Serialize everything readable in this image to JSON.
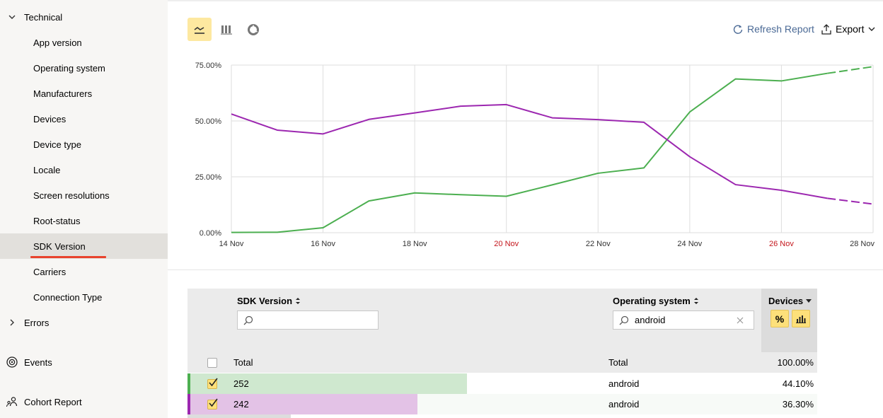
{
  "sidebar": {
    "technical": "Technical",
    "items": [
      "App version",
      "Operating system",
      "Manufacturers",
      "Devices",
      "Device type",
      "Locale",
      "Screen resolutions",
      "Root-status",
      "SDK Version",
      "Carriers",
      "Connection Type"
    ],
    "active_item": "SDK Version",
    "errors": "Errors",
    "events": "Events",
    "cohort": "Cohort Report"
  },
  "toolbar": {
    "chart_types": [
      "line-chart-icon",
      "bar-chart-icon",
      "pie-chart-icon"
    ],
    "active_chart_type": "line-chart-icon",
    "refresh": "Refresh Report",
    "export": "Export"
  },
  "chart_data": {
    "type": "line",
    "x": [
      "14 Nov",
      "15 Nov",
      "16 Nov",
      "17 Nov",
      "18 Nov",
      "19 Nov",
      "20 Nov",
      "21 Nov",
      "22 Nov",
      "23 Nov",
      "24 Nov",
      "25 Nov",
      "26 Nov",
      "27 Nov",
      "28 Nov"
    ],
    "x_tick_labels": [
      "14 Nov",
      "16 Nov",
      "18 Nov",
      "20 Nov",
      "22 Nov",
      "24 Nov",
      "26 Nov",
      "28 Nov"
    ],
    "weekend_ticks": [
      "20 Nov",
      "26 Nov"
    ],
    "y_tick_labels": [
      "0.00%",
      "25.00%",
      "50.00%",
      "75.00%"
    ],
    "ylim": [
      0,
      75
    ],
    "grid": true,
    "series": [
      {
        "color": "#4caf50",
        "values": [
          0.1,
          0.2,
          2.2,
          14.2,
          17.8,
          17.0,
          16.3,
          21.4,
          26.6,
          29.0,
          54.0,
          68.8,
          67.9,
          71.3,
          74.3
        ],
        "dashed_from_index": 13
      },
      {
        "color": "#9c27b0",
        "values": [
          53.1,
          45.9,
          44.2,
          50.7,
          53.6,
          56.6,
          57.3,
          51.4,
          50.6,
          49.4,
          34.0,
          21.5,
          19.0,
          15.4,
          12.8
        ],
        "dashed_from_index": 13
      }
    ]
  },
  "table": {
    "col_sdk": "SDK Version",
    "col_os": "Operating system",
    "col_devices": "Devices",
    "sdk_filter_value": "",
    "os_filter_value": "android",
    "pct_toggle": "%",
    "total_row": {
      "sdk": "Total",
      "os": "Total",
      "devices": "100.00%"
    },
    "rows": [
      {
        "sdk": "252",
        "os": "android",
        "devices": "44.10%",
        "share": 44.1,
        "color": "#4caf50",
        "fill": "#cfe8cf",
        "bg": "#ffffff"
      },
      {
        "sdk": "242",
        "os": "android",
        "devices": "36.30%",
        "share": 36.3,
        "color": "#9c27b0",
        "fill": "#e3c2e6",
        "bg": "#f7faf7"
      }
    ]
  }
}
